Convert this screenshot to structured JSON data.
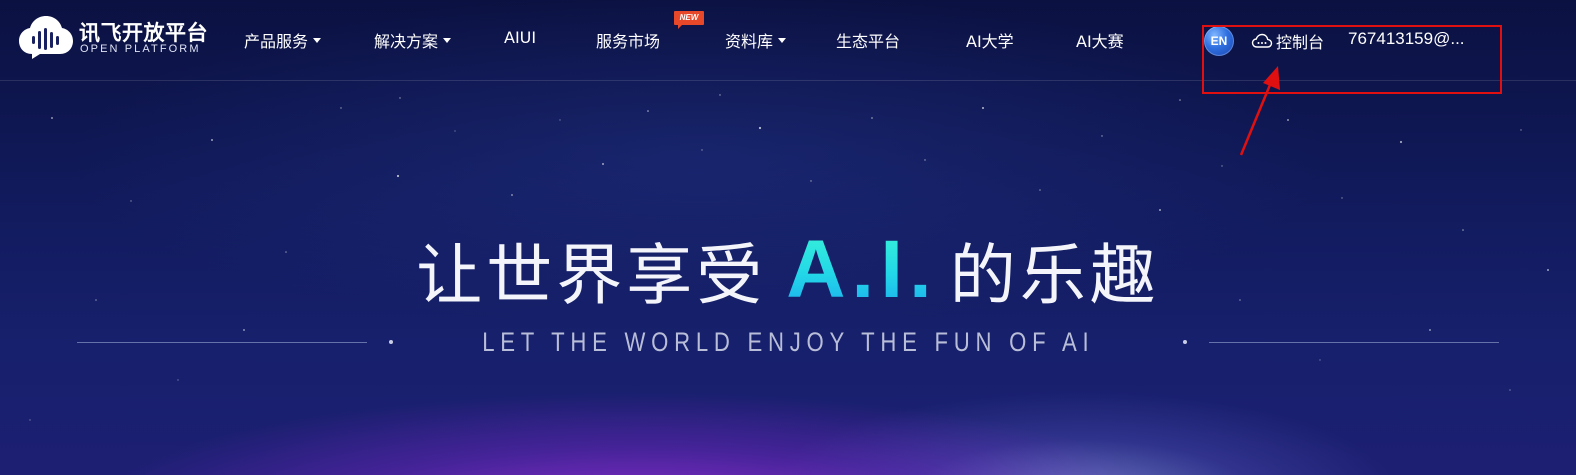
{
  "logo": {
    "name_cn": "讯飞开放平台",
    "name_en": "OPEN PLATFORM"
  },
  "nav": {
    "items": [
      {
        "label": "产品服务",
        "has_dropdown": true
      },
      {
        "label": "解决方案",
        "has_dropdown": true
      },
      {
        "label": "AIUI",
        "has_dropdown": false
      },
      {
        "label": "服务市场",
        "has_dropdown": false,
        "badge": "NEW"
      },
      {
        "label": "资料库",
        "has_dropdown": true
      },
      {
        "label": "生态平台",
        "has_dropdown": false
      },
      {
        "label": "AI大学",
        "has_dropdown": false
      },
      {
        "label": "AI大赛",
        "has_dropdown": false
      }
    ]
  },
  "header_right": {
    "language": "EN",
    "console_label": "控制台",
    "console_icon": "cloud-icon",
    "user": "767413159@..."
  },
  "hero": {
    "title_before": "让世界享受",
    "title_highlight": "A.I.",
    "title_after": "的乐趣",
    "subtitle": "LET THE WORLD ENJOY THE FUN OF AI"
  },
  "annotation": {
    "box_color": "#e01010",
    "arrow_color": "#e01010"
  },
  "colors": {
    "background": "#111a5b",
    "accent_cyan": "#2ee6e0",
    "badge": "#e8482a"
  }
}
